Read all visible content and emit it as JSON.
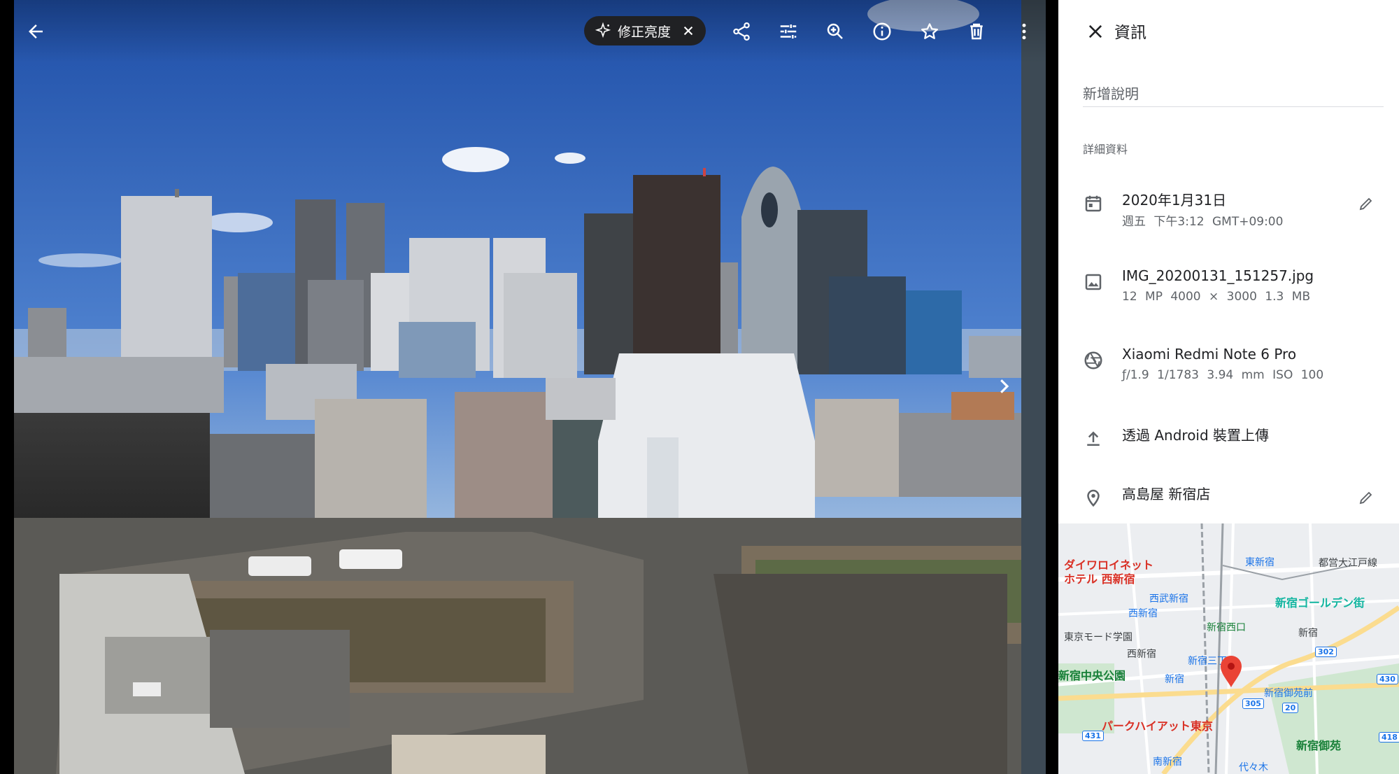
{
  "viewer": {
    "enhance_chip": {
      "label": "修正亮度"
    },
    "toolbar_icons": [
      "share-icon",
      "tune-icon",
      "zoom-in-icon",
      "info-icon",
      "star-icon",
      "delete-icon",
      "more-vert-icon"
    ]
  },
  "panel": {
    "title": "資訊",
    "description_placeholder": "新增說明",
    "details_label": "詳細資料",
    "date": {
      "primary": "2020年1月31日",
      "secondary": "週五 下午3:12   GMT+09:00"
    },
    "file": {
      "primary": "IMG_20200131_151257.jpg",
      "secondary": "12 MP   4000 × 3000   1.3 MB"
    },
    "camera": {
      "primary": "Xiaomi Redmi Note 6 Pro",
      "secondary": "ƒ/1.9   1/1783   3.94 mm   ISO 100"
    },
    "upload": {
      "primary": "透過 Android 裝置上傳"
    },
    "location": {
      "primary": "高島屋 新宿店"
    }
  },
  "map": {
    "labels": [
      {
        "text": "ダイワロイネット",
        "color": "#d93025"
      },
      {
        "text": "ホテル 西新宿",
        "color": "#d93025"
      },
      {
        "text": "東新宿",
        "color": "#1a73e8"
      },
      {
        "text": "都営大江戸線",
        "color": "#3c4043"
      },
      {
        "text": "西武新宿",
        "color": "#1a73e8"
      },
      {
        "text": "西新宿",
        "color": "#1a73e8"
      },
      {
        "text": "新宿ゴールデン街",
        "color": "#12b5a0"
      },
      {
        "text": "新宿西口",
        "color": "#188038"
      },
      {
        "text": "東京モード学園",
        "color": "#3c4043"
      },
      {
        "text": "新宿",
        "color": "#3c4043"
      },
      {
        "text": "西新宿",
        "color": "#3c4043"
      },
      {
        "text": "新宿三丁目",
        "color": "#1a73e8"
      },
      {
        "text": "新宿中央公園",
        "color": "#188038"
      },
      {
        "text": "新宿",
        "color": "#1a73e8"
      },
      {
        "text": "新宿御苑前",
        "color": "#1a73e8"
      },
      {
        "text": "パークハイアット東京",
        "color": "#d93025"
      },
      {
        "text": "新宿御苑",
        "color": "#188038"
      },
      {
        "text": "南新宿",
        "color": "#1a73e8"
      },
      {
        "text": "代々木",
        "color": "#1a73e8"
      }
    ],
    "route_shields": [
      "302",
      "305",
      "430",
      "20",
      "431",
      "418"
    ],
    "pin_color": "#ea4335"
  }
}
